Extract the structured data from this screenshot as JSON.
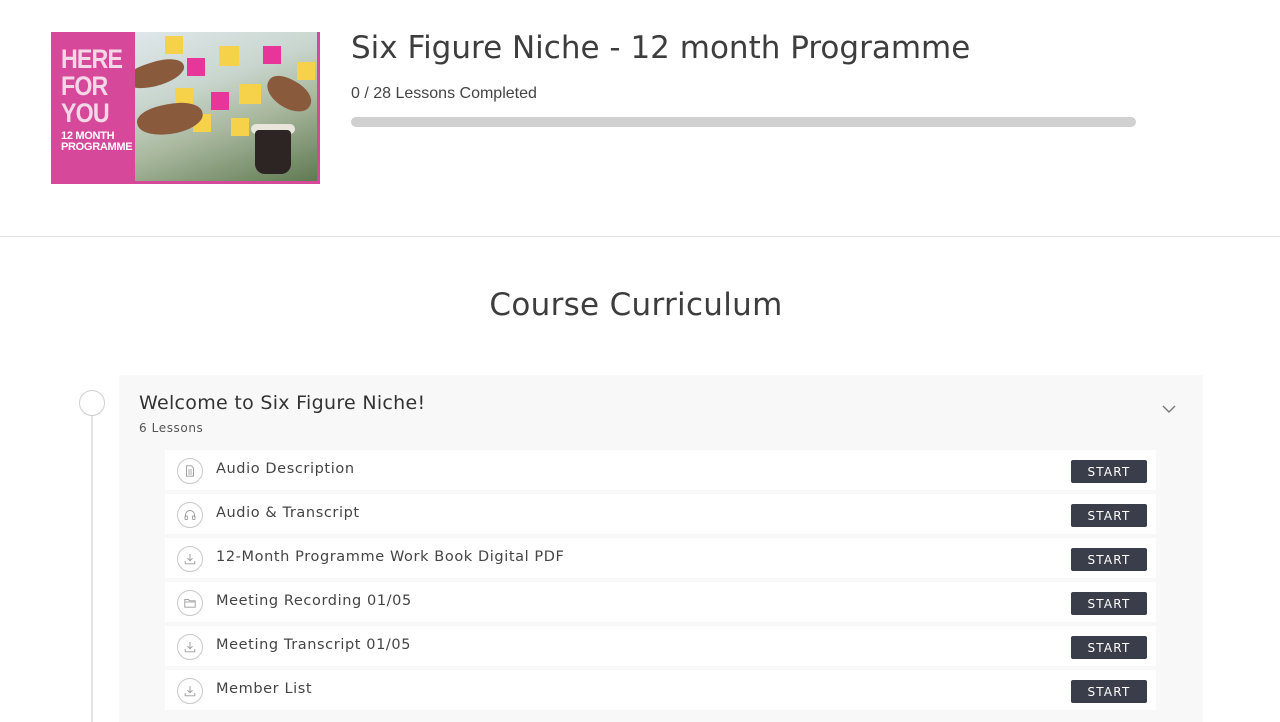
{
  "course": {
    "thumbnail": {
      "headline_lines": [
        "HERE",
        "FOR",
        "YOU"
      ],
      "subline_lines": [
        "12 MONTH",
        "PROGRAMME"
      ],
      "background_color": "#d6489a"
    },
    "title": "Six Figure Niche - 12 month Programme",
    "progress_text": "0 / 28 Lessons Completed",
    "progress_fraction": 0
  },
  "curriculum": {
    "heading": "Course Curriculum",
    "sections": [
      {
        "title": "Welcome to Six Figure Niche!",
        "count": "6 Lessons",
        "toggle_icon": "chevron-down-icon",
        "lessons": [
          {
            "label": "Audio Description",
            "icon": "document-icon",
            "button": "START"
          },
          {
            "label": "Audio & Transcript",
            "icon": "headphones-icon",
            "button": "START"
          },
          {
            "label": "12-Month Programme Work Book Digital PDF",
            "icon": "download-icon",
            "button": "START"
          },
          {
            "label": "Meeting Recording 01/05",
            "icon": "folder-icon",
            "button": "START"
          },
          {
            "label": "Meeting Transcript 01/05",
            "icon": "download-icon",
            "button": "START"
          },
          {
            "label": "Member List",
            "icon": "download-icon",
            "button": "START"
          }
        ]
      }
    ]
  },
  "colors": {
    "accent_pink": "#d6489a",
    "button_bg": "#3a3e4b",
    "progress_track": "#d0d0d0",
    "section_bg": "#f8f8f8"
  }
}
